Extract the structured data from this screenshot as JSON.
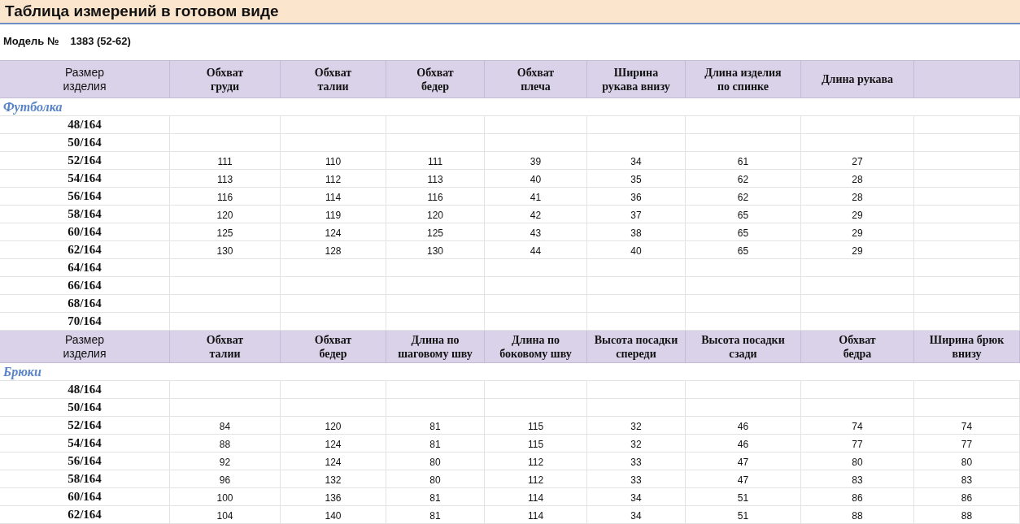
{
  "title": "Таблица измерений в готовом виде",
  "model": {
    "label": "Модель №",
    "value": "1383 (52-62)"
  },
  "sections": [
    {
      "columns": [
        "Размер\nизделия",
        "Обхват\nгруди",
        "Обхват\nталии",
        "Обхват\nбедер",
        "Обхват\nплеча",
        "Ширина\nрукава внизу",
        "Длина изделия\nпо спинке",
        "Длина рукава"
      ],
      "name": "Футболка",
      "rows": [
        {
          "size": "48/164"
        },
        {
          "size": "50/164"
        },
        {
          "size": "52/164",
          "values": [
            "111",
            "110",
            "111",
            "39",
            "34",
            "61",
            "27"
          ]
        },
        {
          "size": "54/164",
          "values": [
            "113",
            "112",
            "113",
            "40",
            "35",
            "62",
            "28"
          ]
        },
        {
          "size": "56/164",
          "values": [
            "116",
            "114",
            "116",
            "41",
            "36",
            "62",
            "28"
          ]
        },
        {
          "size": "58/164",
          "values": [
            "120",
            "119",
            "120",
            "42",
            "37",
            "65",
            "29"
          ]
        },
        {
          "size": "60/164",
          "values": [
            "125",
            "124",
            "125",
            "43",
            "38",
            "65",
            "29"
          ]
        },
        {
          "size": "62/164",
          "values": [
            "130",
            "128",
            "130",
            "44",
            "40",
            "65",
            "29"
          ]
        },
        {
          "size": "64/164"
        },
        {
          "size": "66/164"
        },
        {
          "size": "68/164"
        },
        {
          "size": "70/164"
        }
      ]
    },
    {
      "columns": [
        "Размер\nизделия",
        "Обхват\nталии",
        "Обхват\nбедер",
        "Длина по\nшаговому шву",
        "Длина по\nбоковому шву",
        "Высота посадки\nспереди",
        "Высота посадки\nсзади",
        "Обхват\nбедра",
        "Ширина брюк\nвнизу"
      ],
      "name": "Брюки",
      "rows": [
        {
          "size": "48/164"
        },
        {
          "size": "50/164"
        },
        {
          "size": "52/164",
          "values": [
            "84",
            "120",
            "81",
            "115",
            "32",
            "46",
            "74",
            "74"
          ]
        },
        {
          "size": "54/164",
          "values": [
            "88",
            "124",
            "81",
            "115",
            "32",
            "46",
            "77",
            "77"
          ]
        },
        {
          "size": "56/164",
          "values": [
            "92",
            "124",
            "80",
            "112",
            "33",
            "47",
            "80",
            "80"
          ]
        },
        {
          "size": "58/164",
          "values": [
            "96",
            "132",
            "80",
            "112",
            "33",
            "47",
            "83",
            "83"
          ]
        },
        {
          "size": "60/164",
          "values": [
            "100",
            "136",
            "81",
            "114",
            "34",
            "51",
            "86",
            "86"
          ]
        },
        {
          "size": "62/164",
          "values": [
            "104",
            "140",
            "81",
            "114",
            "34",
            "51",
            "88",
            "88"
          ]
        }
      ]
    }
  ]
}
